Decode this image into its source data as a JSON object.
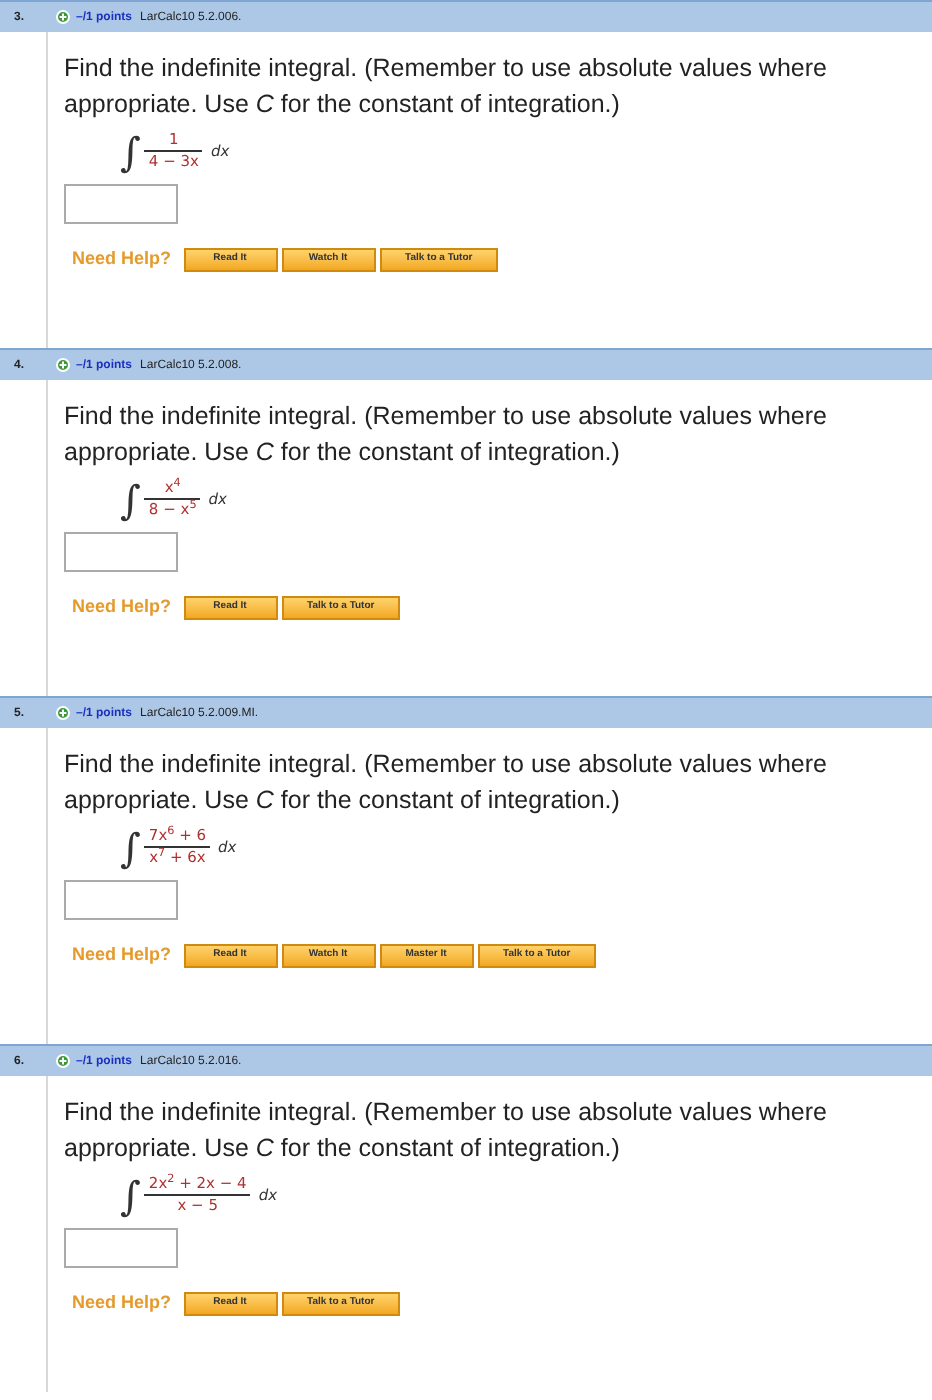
{
  "questions": [
    {
      "number": "3.",
      "points": "–/1 points",
      "source": "LarCalc10 5.2.006.",
      "prompt": "Find the indefinite integral. (Remember to use absolute values where appropriate. Use *C* for the constant of integration.)",
      "integral": {
        "sign": "∫",
        "numerator": "1",
        "denominator": "4 − 3x",
        "differential": "dx"
      },
      "help_label": "Need Help?",
      "help_buttons": [
        "Read It",
        "Watch It",
        "Talk to a Tutor"
      ]
    },
    {
      "number": "4.",
      "points": "–/1 points",
      "source": "LarCalc10 5.2.008.",
      "prompt": "Find the indefinite integral. (Remember to use absolute values where appropriate. Use *C* for the constant of integration.)",
      "integral": {
        "sign": "∫",
        "numerator": "x$^{4}$",
        "denominator": "8 − x$^{5}$",
        "differential": "dx"
      },
      "help_label": "Need Help?",
      "help_buttons": [
        "Read It",
        "Talk to a Tutor"
      ]
    },
    {
      "number": "5.",
      "points": "–/1 points",
      "source": "LarCalc10 5.2.009.MI.",
      "prompt": "Find the indefinite integral. (Remember to use absolute values where appropriate. Use *C* for the constant of integration.)",
      "integral": {
        "sign": "∫",
        "numerator": "7x$^{6}$ + 6",
        "denominator": "x$^{7}$ + 6x",
        "differential": "dx"
      },
      "help_label": "Need Help?",
      "help_buttons": [
        "Read It",
        "Watch It",
        "Master It",
        "Talk to a Tutor"
      ]
    },
    {
      "number": "6.",
      "points": "–/1 points",
      "source": "LarCalc10 5.2.016.",
      "prompt": "Find the indefinite integral. (Remember to use absolute values where appropriate. Use *C* for the constant of integration.)",
      "integral": {
        "sign": "∫",
        "numerator": "2x$^{2}$ + 2x − 4",
        "denominator": "x − 5",
        "differential": "dx"
      },
      "help_label": "Need Help?",
      "help_buttons": [
        "Read It",
        "Talk to a Tutor"
      ]
    }
  ]
}
